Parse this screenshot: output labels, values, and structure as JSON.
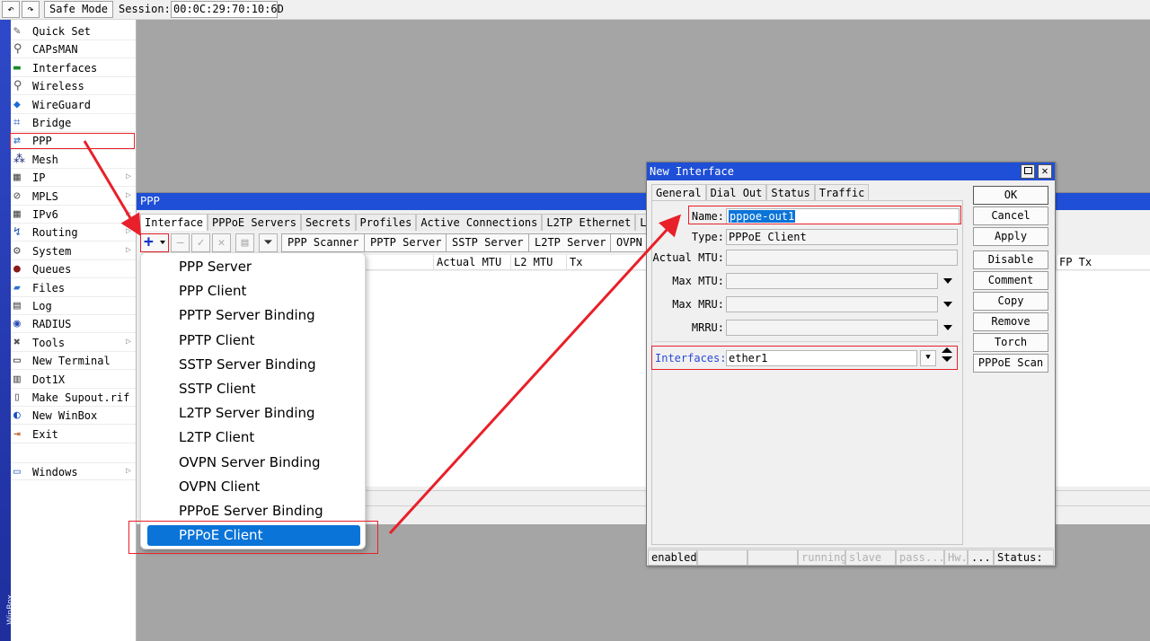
{
  "toolbar": {
    "safe_mode": "Safe Mode",
    "session_label": "Session:",
    "session_value": "00:0C:29:70:10:6D"
  },
  "side_strip": "WinBox",
  "menu": [
    {
      "label": "Quick Set",
      "icon": "quick-set-icon",
      "arrow": false
    },
    {
      "label": "CAPsMAN",
      "icon": "antenna-icon",
      "arrow": false
    },
    {
      "label": "Interfaces",
      "icon": "interfaces-icon",
      "arrow": false
    },
    {
      "label": "Wireless",
      "icon": "antenna-icon",
      "arrow": false
    },
    {
      "label": "WireGuard",
      "icon": "wireguard-icon",
      "arrow": false
    },
    {
      "label": "Bridge",
      "icon": "bridge-icon",
      "arrow": false
    },
    {
      "label": "PPP",
      "icon": "ppp-icon",
      "arrow": false
    },
    {
      "label": "Mesh",
      "icon": "mesh-icon",
      "arrow": false
    },
    {
      "label": "IP",
      "icon": "ip-icon",
      "arrow": true
    },
    {
      "label": "MPLS",
      "icon": "mpls-icon",
      "arrow": true
    },
    {
      "label": "IPv6",
      "icon": "ipv6-icon",
      "arrow": true
    },
    {
      "label": "Routing",
      "icon": "routing-icon",
      "arrow": true
    },
    {
      "label": "System",
      "icon": "gear-icon",
      "arrow": true
    },
    {
      "label": "Queues",
      "icon": "queues-icon",
      "arrow": false
    },
    {
      "label": "Files",
      "icon": "folder-icon",
      "arrow": false
    },
    {
      "label": "Log",
      "icon": "log-icon",
      "arrow": false
    },
    {
      "label": "RADIUS",
      "icon": "radius-icon",
      "arrow": false
    },
    {
      "label": "Tools",
      "icon": "tools-icon",
      "arrow": true
    },
    {
      "label": "New Terminal",
      "icon": "terminal-icon",
      "arrow": false
    },
    {
      "label": "Dot1X",
      "icon": "dot1x-icon",
      "arrow": false
    },
    {
      "label": "Make Supout.rif",
      "icon": "document-icon",
      "arrow": false
    },
    {
      "label": "New WinBox",
      "icon": "winbox-icon",
      "arrow": false
    },
    {
      "label": "Exit",
      "icon": "exit-icon",
      "arrow": false
    }
  ],
  "windows_item": {
    "label": "Windows",
    "icon": "windows-icon"
  },
  "ppp_window": {
    "title": "PPP",
    "tabs": [
      "Interface",
      "PPPoE Servers",
      "Secrets",
      "Profiles",
      "Active Connections",
      "L2TP Ethernet",
      "L2TP"
    ],
    "toolbar_buttons": [
      "PPP Scanner",
      "PPTP Server",
      "SSTP Server",
      "L2TP Server",
      "OVPN"
    ],
    "columns": [
      "Actual MTU",
      "L2 MTU",
      "Tx"
    ],
    "right_column": "FP Tx"
  },
  "dropdown_items": [
    "PPP Server",
    "PPP Client",
    "PPTP Server Binding",
    "PPTP Client",
    "SSTP Server Binding",
    "SSTP Client",
    "L2TP Server Binding",
    "L2TP Client",
    "OVPN Server Binding",
    "OVPN Client",
    "PPPoE Server Binding"
  ],
  "dropdown_selected": "PPPoE Client",
  "dialog": {
    "title": "New Interface",
    "tabs": [
      "General",
      "Dial Out",
      "Status",
      "Traffic"
    ],
    "fields": {
      "name_label": "Name:",
      "name_value": "pppoe-out1",
      "type_label": "Type:",
      "type_value": "PPPoE Client",
      "actual_mtu_label": "Actual MTU:",
      "max_mtu_label": "Max MTU:",
      "max_mru_label": "Max MRU:",
      "mrru_label": "MRRU:",
      "interfaces_label": "Interfaces:",
      "interfaces_value": "ether1"
    },
    "buttons": [
      "OK",
      "Cancel",
      "Apply",
      "Disable",
      "Comment",
      "Copy",
      "Remove",
      "Torch",
      "PPPoE Scan"
    ],
    "status": {
      "enabled": "enabled",
      "running": "running",
      "slave": "slave",
      "pass": "pass...",
      "hw": "Hw.",
      "dots": "...",
      "status": "Status:"
    }
  },
  "colors": {
    "accent": "#1f4fd6",
    "highlight": "#e8202a",
    "selection": "#0a74d8"
  }
}
